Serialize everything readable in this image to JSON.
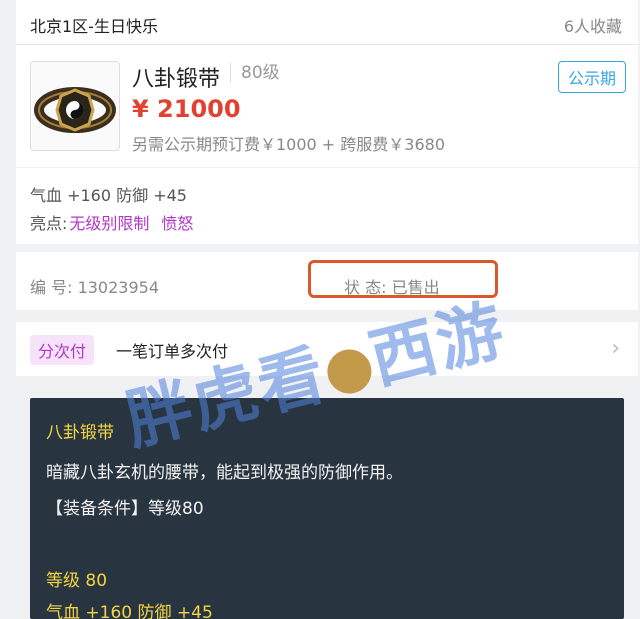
{
  "header": {
    "server": "北京1区-生日快乐",
    "favorites": "6人收藏"
  },
  "item": {
    "name": "八卦锻带",
    "level": "80级",
    "tag": "公示期",
    "price": "¥ 21000",
    "fee": "另需公示期预订费￥1000 + 跨服费￥3680",
    "icon": "bagua-belt-icon"
  },
  "attributes": {
    "stats": "气血 +160 防御 +45",
    "highlight_label": "亮点:",
    "highlight_1": "无级别限制",
    "highlight_2": "愤怒"
  },
  "info": {
    "id": "编 号: 13023954",
    "status": "状 态: 已售出"
  },
  "payment": {
    "tag": "分次付",
    "text": "一笔订单多次付",
    "chevron": "›"
  },
  "tooltip": {
    "title": "八卦锻带",
    "description": "暗藏八卦玄机的腰带，能起到极强的防御作用。",
    "requirement": "【装备条件】等级80",
    "level": "等级 80",
    "stats": "气血 +160 防御 +45"
  },
  "watermark": {
    "text_left": "胖虎看",
    "text_right": "西游"
  },
  "colors": {
    "price": "#e3412f",
    "highlight": "#b436c7",
    "accent": "#3aa5e0",
    "status_box": "#d9582e",
    "tooltip_bg": "#283540",
    "tooltip_gold": "#f4d442"
  }
}
